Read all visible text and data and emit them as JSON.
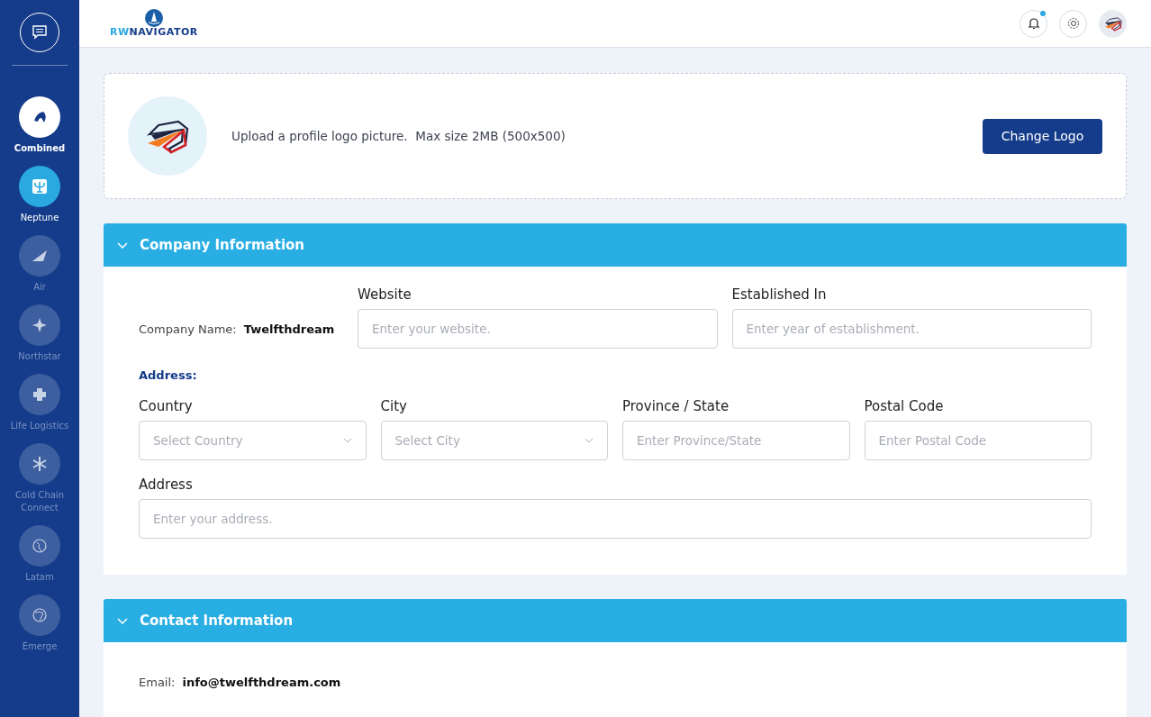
{
  "sidebar": {
    "items": [
      {
        "label": "Combined",
        "selected": true,
        "enabled": true
      },
      {
        "label": "Neptune",
        "selected": false,
        "enabled": true
      },
      {
        "label": "Air",
        "selected": false,
        "enabled": false
      },
      {
        "label": "Northstar",
        "selected": false,
        "enabled": false
      },
      {
        "label": "Life Logistics",
        "selected": false,
        "enabled": false
      },
      {
        "label": "Cold Chain Connect",
        "selected": false,
        "enabled": false
      },
      {
        "label": "Latam",
        "selected": false,
        "enabled": false
      },
      {
        "label": "Emerge",
        "selected": false,
        "enabled": false
      }
    ]
  },
  "header": {
    "logo": {
      "prefix": "RW",
      "name": "NAVIGATOR"
    },
    "notifications_unread": true
  },
  "upload": {
    "text": "Upload a profile logo picture.  Max size 2MB (500x500)",
    "button": "Change Logo"
  },
  "sections": [
    {
      "title": "Company Information",
      "expanded": true,
      "rows": [
        [
          {
            "kind": "info",
            "label": "Company Name:",
            "value": "Twelfthdream"
          },
          {
            "kind": "text",
            "label": "Website",
            "placeholder": "Enter your website."
          },
          {
            "kind": "text",
            "label": "Established In",
            "placeholder": "Enter year of establishment."
          }
        ],
        [
          {
            "kind": "heading",
            "text": "Address:"
          }
        ],
        [
          {
            "kind": "select",
            "label": "Country",
            "placeholder": "Select Country"
          },
          {
            "kind": "select",
            "label": "City",
            "placeholder": "Select City"
          },
          {
            "kind": "text",
            "label": "Province / State",
            "placeholder": "Enter Province/State"
          },
          {
            "kind": "text",
            "label": "Postal Code",
            "placeholder": "Enter Postal Code"
          }
        ],
        [
          {
            "kind": "text",
            "label": "Address",
            "placeholder": "Enter your address."
          }
        ]
      ]
    },
    {
      "title": "Contact Information",
      "expanded": true,
      "rows": [
        [
          {
            "kind": "info",
            "label": "Email:",
            "value": "info@twelfthdream.com"
          }
        ]
      ]
    }
  ]
}
